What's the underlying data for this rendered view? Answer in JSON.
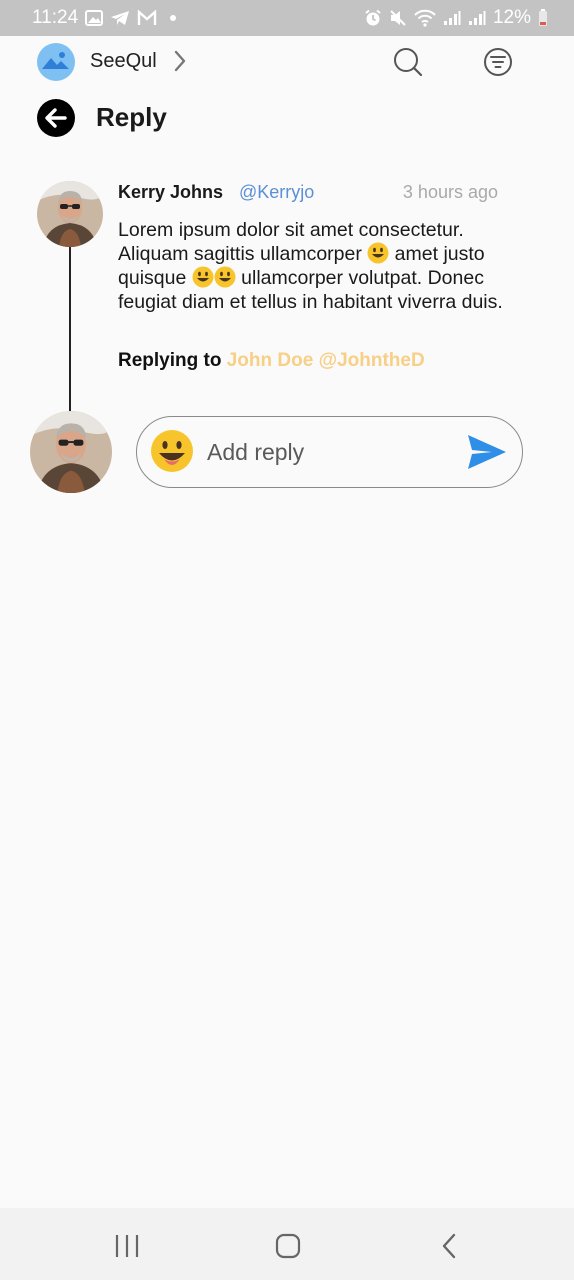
{
  "status_bar": {
    "time": "11:24",
    "battery": "12%",
    "left_icons": [
      "gallery-icon",
      "telegram-icon",
      "gmail-icon",
      "dot-icon"
    ],
    "right_icons": [
      "alarm-icon",
      "mute-icon",
      "wifi-icon",
      "signal-icon",
      "signal-icon",
      "battery-icon"
    ]
  },
  "app_bar": {
    "app_name": "SeeQul",
    "icons": {
      "logo": "image-logo-icon",
      "chevron": "chevron-right-icon",
      "search": "search-icon",
      "filter": "filter-icon"
    }
  },
  "header": {
    "title": "Reply",
    "back_icon": "arrow-left-icon"
  },
  "comment": {
    "author": "Kerry Johns",
    "handle": "@Kerryjo",
    "time": "3 hours ago",
    "body_parts": [
      "Lorem ipsum dolor sit amet consectetur. Aliquam sagittis ullamcorper ",
      " amet justo quisque ",
      " ullamcorper volutpat. Donec feugiat diam et tellus in habitant viverra duis."
    ],
    "replying_label": "Replying to",
    "replying_target": "John Doe @JohntheD"
  },
  "reply_input": {
    "placeholder": "Add reply",
    "value": "",
    "emoji_icon": "smiley-emoji-icon",
    "send_icon": "send-icon"
  },
  "nav_bar": {
    "icons": [
      "recent-apps-icon",
      "home-icon",
      "back-icon"
    ]
  },
  "colors": {
    "status_bar_bg": "#c3c3c3",
    "background": "#fafafa",
    "handle": "#5b8fd6",
    "timestamp": "#a9a9a9",
    "reply_target": "#f7cf86",
    "send": "#2f8fe6"
  }
}
